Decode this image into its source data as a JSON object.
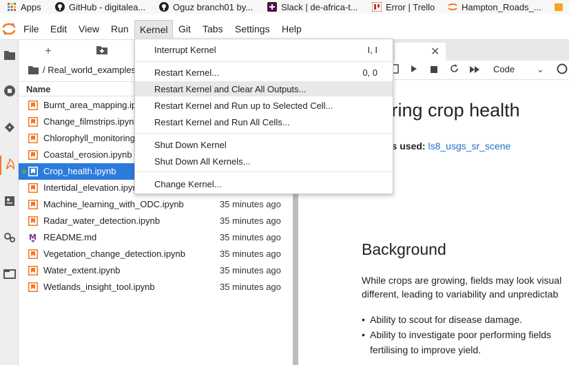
{
  "bookmarks": [
    {
      "label": "Apps",
      "icon": "apps-grid-icon"
    },
    {
      "label": "GitHub - digitalea...",
      "icon": "github-icon"
    },
    {
      "label": "Oguz branch01 by...",
      "icon": "github-icon"
    },
    {
      "label": "Slack | de-africa-t...",
      "icon": "slack-icon"
    },
    {
      "label": "Error | Trello",
      "icon": "trello-icon"
    },
    {
      "label": "Hampton_Roads_...",
      "icon": "jupyter-icon"
    }
  ],
  "menubar": {
    "items": [
      "File",
      "Edit",
      "View",
      "Run",
      "Kernel",
      "Git",
      "Tabs",
      "Settings",
      "Help"
    ],
    "active": "Kernel"
  },
  "kernel_menu": {
    "groups": [
      [
        {
          "label": "Interrupt Kernel",
          "shortcut": "I, I"
        }
      ],
      [
        {
          "label": "Restart Kernel...",
          "shortcut": "0, 0"
        },
        {
          "label": "Restart Kernel and Clear All Outputs...",
          "shortcut": ""
        },
        {
          "label": "Restart Kernel and Run up to Selected Cell...",
          "shortcut": ""
        },
        {
          "label": "Restart Kernel and Run All Cells...",
          "shortcut": ""
        }
      ],
      [
        {
          "label": "Shut Down Kernel",
          "shortcut": ""
        },
        {
          "label": "Shut Down All Kernels...",
          "shortcut": ""
        }
      ],
      [
        {
          "label": "Change Kernel...",
          "shortcut": ""
        }
      ]
    ],
    "highlighted": "Restart Kernel and Clear All Outputs..."
  },
  "filebrowser": {
    "breadcrumb": "/ Real_world_examples",
    "column_name": "Name",
    "files": [
      {
        "name": "Burnt_area_mapping.ipynb",
        "modified": "",
        "type": "notebook"
      },
      {
        "name": "Change_filmstrips.ipynb",
        "modified": "",
        "type": "notebook"
      },
      {
        "name": "Chlorophyll_monitoring.ipynb",
        "modified": "",
        "type": "notebook"
      },
      {
        "name": "Coastal_erosion.ipynb",
        "modified": "",
        "type": "notebook"
      },
      {
        "name": "Crop_health.ipynb",
        "modified": "",
        "type": "notebook",
        "selected": true,
        "running": true
      },
      {
        "name": "Intertidal_elevation.ipynb",
        "modified": "",
        "type": "notebook"
      },
      {
        "name": "Machine_learning_with_ODC.ipynb",
        "modified": "35 minutes ago",
        "type": "notebook"
      },
      {
        "name": "Radar_water_detection.ipynb",
        "modified": "35 minutes ago",
        "type": "notebook"
      },
      {
        "name": "README.md",
        "modified": "35 minutes ago",
        "type": "markdown"
      },
      {
        "name": "Vegetation_change_detection.ipynb",
        "modified": "35 minutes ago",
        "type": "notebook"
      },
      {
        "name": "Water_extent.ipynb",
        "modified": "35 minutes ago",
        "type": "notebook"
      },
      {
        "name": "Wetlands_insight_tool.ipynb",
        "modified": "35 minutes ago",
        "type": "notebook"
      }
    ]
  },
  "notebook": {
    "cell_type": "Code",
    "title": "asuring crop health",
    "products_label": "roducts used:",
    "products_value": "ls8_usgs_sr_scene",
    "background_heading": "Background",
    "para1": "While crops are growing, fields may look visual",
    "para2": "different, leading to variability and unpredictab",
    "bullets": [
      {
        "line1": "Ability to scout for disease damage.",
        "line2": ""
      },
      {
        "line1": "Ability to investigate poor performing fields",
        "line2": "fertilising to improve yield."
      }
    ]
  },
  "colors": {
    "accent": "#f37626",
    "selection": "#2b7bdc",
    "link": "#1a73c7",
    "notebook_icon": "#f37626",
    "markdown_icon": "#7b2a9c"
  }
}
